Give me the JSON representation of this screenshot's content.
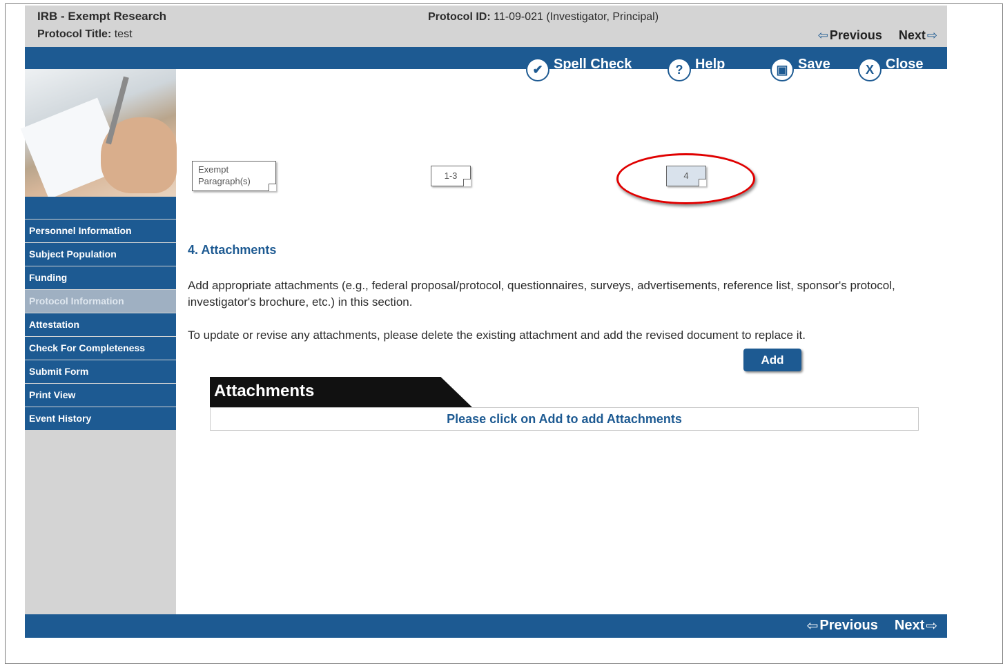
{
  "header": {
    "app_title": "IRB - Exempt Research",
    "protocol_title_label": "Protocol Title:",
    "protocol_title_value": "test",
    "protocol_id_label": "Protocol ID:",
    "protocol_id_value": "11-09-021 (Investigator, Principal)",
    "previous_label": "Previous",
    "next_label": "Next",
    "arrow_left_icon": "⇦",
    "arrow_right_icon": "⇨"
  },
  "toolbar": {
    "spell_check": "Spell Check",
    "help": "Help",
    "save": "Save",
    "close": "Close",
    "icons": {
      "spell_check": "✔",
      "help": "?",
      "save": "▣",
      "close": "X"
    }
  },
  "sidebar": {
    "items": [
      {
        "label": "Personnel Information",
        "active": false
      },
      {
        "label": "Subject Population",
        "active": false
      },
      {
        "label": "Funding",
        "active": false
      },
      {
        "label": "Protocol Information",
        "active": true
      },
      {
        "label": "Attestation",
        "active": false
      },
      {
        "label": "Check For Completeness",
        "active": false
      },
      {
        "label": "Submit Form",
        "active": false
      },
      {
        "label": "Print View",
        "active": false
      },
      {
        "label": "Event History",
        "active": false
      }
    ]
  },
  "tabs": {
    "exempt_line1": "Exempt",
    "exempt_line2": "Paragraph(s)",
    "tab_1_3": "1-3",
    "tab_4": "4"
  },
  "main": {
    "section_title": "4. Attachments",
    "paragraph1": "Add appropriate attachments (e.g., federal proposal/protocol, questionnaires, surveys, advertisements, reference list, sponsor's protocol, investigator's brochure, etc.) in this section.",
    "paragraph2": "To update or revise any attachments, please delete the existing attachment and add the revised document to replace it.",
    "add_button": "Add",
    "attachments_header": "Attachments",
    "attachments_empty": "Please click on Add to add Attachments"
  },
  "footer": {
    "previous_label": "Previous",
    "next_label": "Next"
  },
  "colors": {
    "brand_blue": "#1d5a92",
    "highlight_ring": "#e00000",
    "header_gray": "#d4d4d4"
  }
}
